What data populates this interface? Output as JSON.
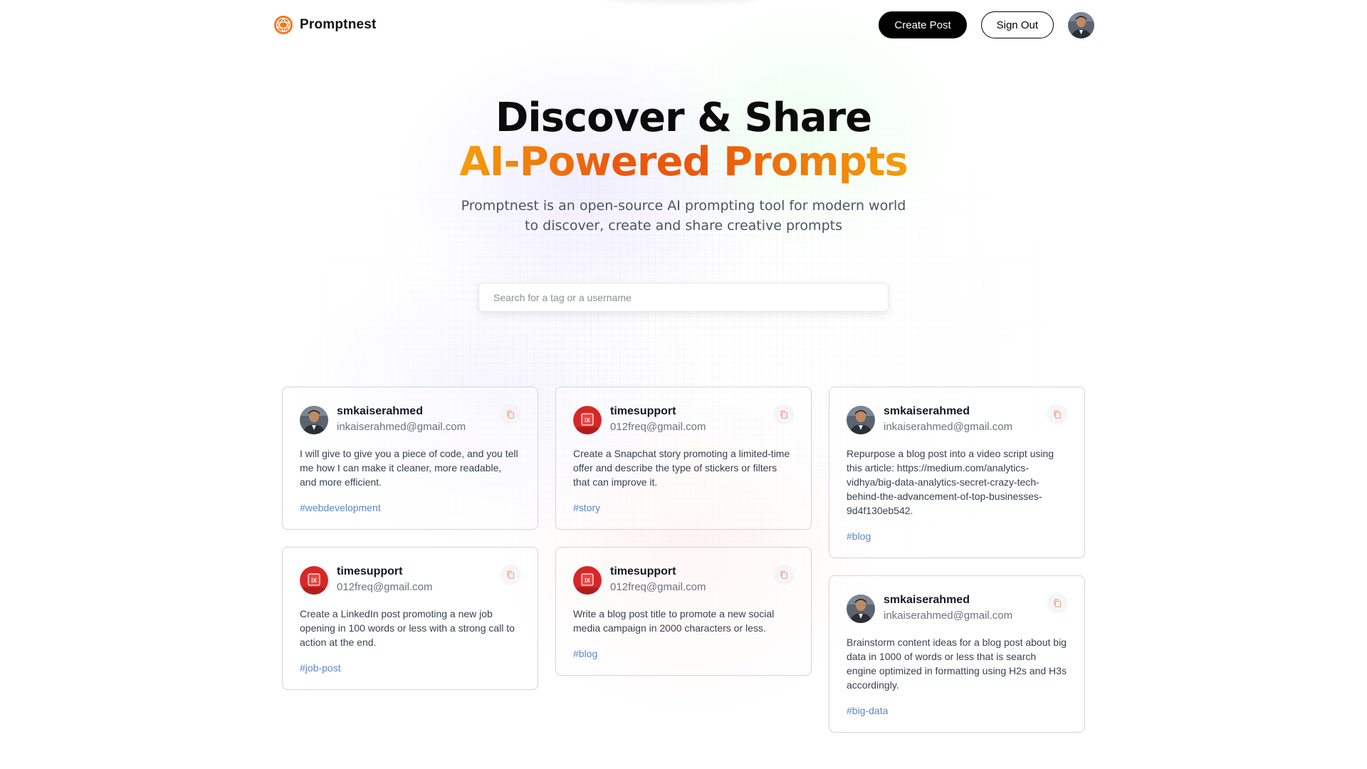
{
  "nav": {
    "brand": "Promptnest",
    "create_label": "Create Post",
    "signout_label": "Sign Out"
  },
  "hero": {
    "title_line1": "Discover & Share",
    "title_line2": "AI-Powered Prompts",
    "description": "Promptnest is an open-source AI prompting tool for modern world to discover, create and share creative prompts"
  },
  "search": {
    "placeholder": "Search for a tag or a username",
    "value": ""
  },
  "colors": {
    "accent_orange": "#ea580c",
    "accent_amber": "#f59e0b",
    "tag_blue": "#5b87c9",
    "timesupport_red": "#d62828"
  },
  "cards": [
    {
      "username": "smkaiserahmed",
      "email": "inkaiserahmed@gmail.com",
      "avatar": "person-avatar",
      "prompt": "I will give to give you a piece of code, and you tell me how I can make it cleaner, more readable, and more efficient.",
      "tag": "#webdevelopment"
    },
    {
      "username": "timesupport",
      "email": "012freq@gmail.com",
      "avatar": "ix-logo-avatar",
      "prompt": "Create a Snapchat story promoting a limited-time offer and describe the type of stickers or filters that can improve it.",
      "tag": "#story"
    },
    {
      "username": "smkaiserahmed",
      "email": "inkaiserahmed@gmail.com",
      "avatar": "person-avatar",
      "prompt": "Repurpose a blog post into a video script using this article: https://medium.com/analytics-vidhya/big-data-analytics-secret-crazy-tech-behind-the-advancement-of-top-businesses-9d4f130eb542.",
      "tag": "#blog"
    },
    {
      "username": "timesupport",
      "email": "012freq@gmail.com",
      "avatar": "ix-logo-avatar",
      "prompt": "Create a LinkedIn post promoting a new job opening in 100 words or less with a strong call to action at the end.",
      "tag": "#job-post"
    },
    {
      "username": "timesupport",
      "email": "012freq@gmail.com",
      "avatar": "ix-logo-avatar",
      "prompt": "Write a blog post title to promote a new social media campaign in 2000 characters or less.",
      "tag": "#blog"
    },
    {
      "username": "smkaiserahmed",
      "email": "inkaiserahmed@gmail.com",
      "avatar": "person-avatar",
      "prompt": "Brainstorm content ideas for a blog post about big data in 1000 of words or less that is search engine optimized in formatting using H2s and H3s accordingly.",
      "tag": "#big-data"
    }
  ]
}
